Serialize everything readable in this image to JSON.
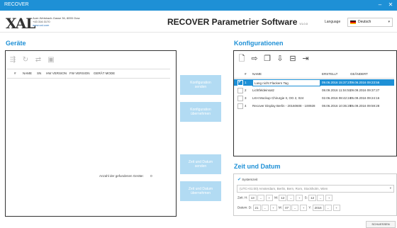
{
  "window": {
    "title": "RECOVER",
    "minimize": "–",
    "close": "✕"
  },
  "header": {
    "logo": "XAL",
    "address_line1": "Auer-Welsbach-Gasse 36, 8055 Graz",
    "address_line2": "+43 316 3170",
    "website": "www.xal.com",
    "app_title": "RECOVER Parametrier Software",
    "version": "V1.0.0",
    "language_label": "Language",
    "language_value": "Deutsch"
  },
  "geraete": {
    "title": "Geräte",
    "columns": [
      "#",
      "NAME",
      "SN",
      "HW VERSION",
      "FW VERSION",
      "GERÄT MODE"
    ],
    "found_label": "Anzahl der gefundenen Geräte:",
    "found_count": "0"
  },
  "middle_buttons": [
    {
      "label": "Konfiguration\nsenden"
    },
    {
      "label": "Konfiguration\nübernehmen"
    },
    {
      "label": "Zeit und Datum\nsenden"
    },
    {
      "label": "Zeit und Datum\nübernehmen"
    }
  ],
  "konfigurationen": {
    "title": "Konfigurationen",
    "columns": [
      "#",
      "NAME",
      "ERSTELLT",
      "GEÄNDERT"
    ],
    "rows": [
      {
        "num": "1",
        "name": "Lang nicht Flackern Tag",
        "created": "09.06.2016 15:37:27",
        "modified": "09.06.2016 09:23:56",
        "selected": true
      },
      {
        "num": "2",
        "name": "Lichtfeldeinsatz",
        "created": "08.09.2016 11:04:51",
        "modified": "09.09.2016 09:37:27",
        "selected": false
      },
      {
        "num": "3",
        "name": "LKH Mockup Chirurgie II, OG 2, 024",
        "created": "02.06.2016 08:42:24",
        "modified": "05.09.2016 09:24:16",
        "selected": false
      },
      {
        "num": "4",
        "name": "Recover Display Berlin - 20160608 - 100928",
        "created": "08.06.2016 10:35:20",
        "modified": "05.09.2016 09:59:28",
        "selected": false
      }
    ]
  },
  "zeit": {
    "title": "Zeit und Datum",
    "systemzeit_label": "Systemzeit",
    "timezone": "(UTC+01:00) Amsterdam, Berlin, Bern, Rom, Stockholm, Wien",
    "time_label": "Zeit:",
    "h_label": "H:",
    "h_value": "13",
    "m_label": "M:",
    "m_value": "12",
    "s_label": "S:",
    "s_value": "12",
    "date_label": "Datum:",
    "d_label": "D:",
    "d_value": "21",
    "mo_label": "M:",
    "mo_value": "07",
    "y_label": "Y:",
    "y_value": "2016",
    "minus": "–",
    "plus": "+"
  },
  "footer": {
    "save": "SCHLIESSEN"
  }
}
